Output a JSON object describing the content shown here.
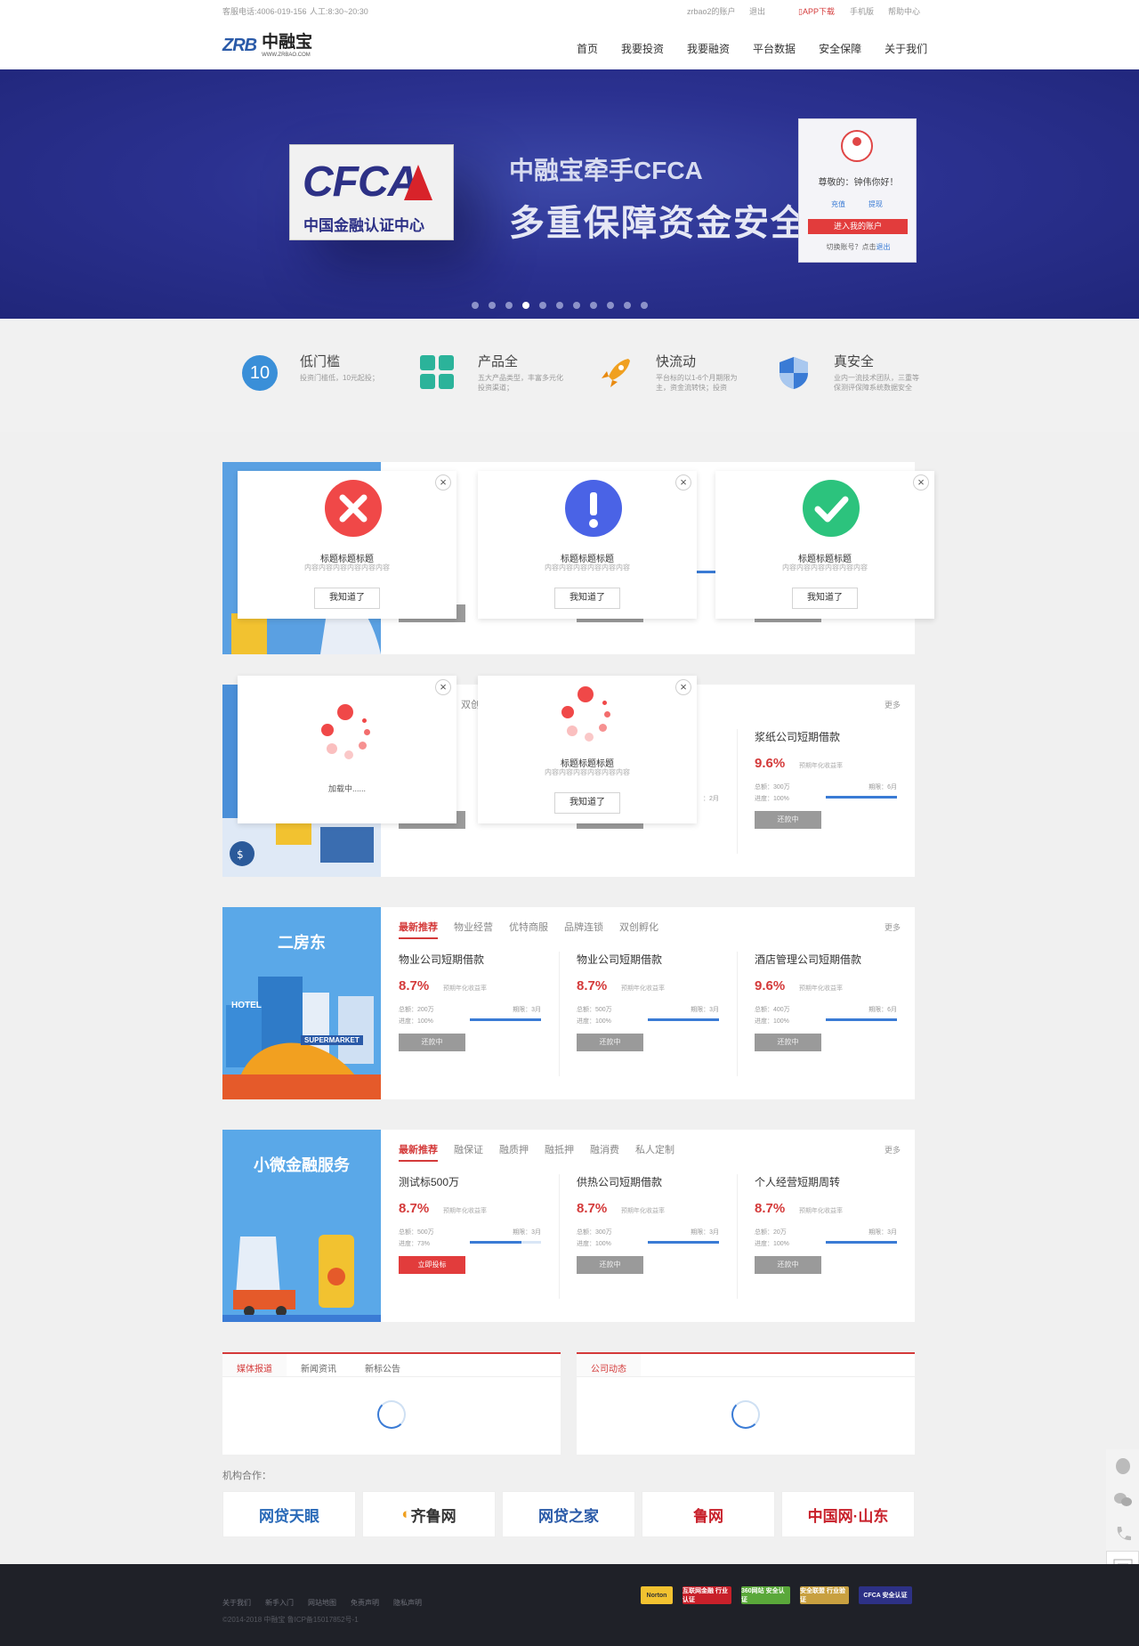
{
  "topbar": {
    "hotline": "客服电话:4006-019-156",
    "hours": "人工:8:30~20:30",
    "account": "zrbao2的账户",
    "logout": "退出",
    "app": "APP下载",
    "mobile": "手机版",
    "help": "帮助中心"
  },
  "header": {
    "logo_mark": "ZRB",
    "logo_cn": "中融宝",
    "logo_url": "WWW.ZRBAO.COM",
    "nav": [
      "首页",
      "我要投资",
      "我要融资",
      "平台数据",
      "安全保障",
      "关于我们"
    ]
  },
  "banner": {
    "cfca_big": "CFCA",
    "cfca_sub": "中国金融认证中心",
    "line1": "中融宝牵手CFCA",
    "line2": "多重保障资金安全",
    "dot_count": 11,
    "active_dot": 3
  },
  "login": {
    "greeting": "尊敬的：钟伟你好！",
    "recharge": "充值",
    "withdraw": "提现",
    "enter": "进入我的账户",
    "switch_text": "切换账号？点击",
    "switch_link": "退出"
  },
  "features": [
    {
      "icon": "ten-badge-icon",
      "icon_text": "10",
      "title": "低门槛",
      "desc": "投资门槛低，10元起投；"
    },
    {
      "icon": "grid-icon",
      "title": "产品全",
      "desc": "五大产品类型，丰富多元化投资渠道；"
    },
    {
      "icon": "rocket-icon",
      "title": "快流动",
      "desc": "平台标的以1-6个月期限为主，资金流转快；投资"
    },
    {
      "icon": "shield-icon",
      "title": "真安全",
      "desc": "业内一流技术团队，三重等保测评保障系统数据安全"
    }
  ],
  "sections": [
    {
      "name": "section-1",
      "more": "更多",
      "tabs": [],
      "items": [
        {
          "name": "",
          "rate": "",
          "rate_label": "",
          "total": "",
          "term": "",
          "progress": "",
          "progress_value": null,
          "button": ""
        }
      ]
    },
    {
      "name": "section-2",
      "more": "更多",
      "tabs": [
        "双创"
      ],
      "items": [
        {
          "name": "浆纸公司短期借款",
          "rate": "9.6%",
          "rate_label": "预期年化收益率",
          "total": "总额：300万",
          "term": "期限：6月",
          "progress": "进度：100%",
          "progress_value": 1.0,
          "button": "还款中"
        }
      ],
      "partial": {
        "suffix1": "式",
        "term2": "：2月",
        "button1": "还款中",
        "button2": "还款中"
      }
    },
    {
      "name": "section-property",
      "banner_title": "二房东",
      "banner_hotel": "HOTEL",
      "banner_market": "SUPERMARKET",
      "more": "更多",
      "tabs": [
        "最新推荐",
        "物业经营",
        "优特商服",
        "品牌连锁",
        "双创孵化"
      ],
      "items": [
        {
          "name": "物业公司短期借款",
          "rate": "8.7%",
          "rate_label": "预期年化收益率",
          "total": "总额：200万",
          "term": "期限：3月",
          "progress": "进度：100%",
          "progress_value": 1.0,
          "button": "还款中"
        },
        {
          "name": "物业公司短期借款",
          "rate": "8.7%",
          "rate_label": "预期年化收益率",
          "total": "总额：500万",
          "term": "期限：3月",
          "progress": "进度：100%",
          "progress_value": 1.0,
          "button": "还款中"
        },
        {
          "name": "酒店管理公司短期借款",
          "rate": "9.6%",
          "rate_label": "预期年化收益率",
          "total": "总额：400万",
          "term": "期限：6月",
          "progress": "进度：100%",
          "progress_value": 1.0,
          "button": "还款中"
        }
      ]
    },
    {
      "name": "section-micro",
      "banner_title": "小微金融服务",
      "more": "更多",
      "tabs": [
        "最新推荐",
        "融保证",
        "融质押",
        "融抵押",
        "融消费",
        "私人定制"
      ],
      "items": [
        {
          "name": "测试标500万",
          "rate": "8.7%",
          "rate_label": "预期年化收益率",
          "total": "总额：500万",
          "term": "期限：3月",
          "progress": "进度：73%",
          "progress_value": 0.73,
          "button": "立即投标"
        },
        {
          "name": "供热公司短期借款",
          "rate": "8.7%",
          "rate_label": "预期年化收益率",
          "total": "总额：300万",
          "term": "期限：3月",
          "progress": "进度：100%",
          "progress_value": 1.0,
          "button": "还款中"
        },
        {
          "name": "个人经营短期周转",
          "rate": "8.7%",
          "rate_label": "预期年化收益率",
          "total": "总额：20万",
          "term": "期限：3月",
          "progress": "进度：100%",
          "progress_value": 1.0,
          "button": "还款中"
        }
      ]
    }
  ],
  "news": {
    "left_tabs": [
      "媒体报道",
      "新闻资讯",
      "新标公告"
    ],
    "right_tabs": [
      "公司动态"
    ]
  },
  "partners": {
    "label": "机构合作：",
    "logos": [
      "网贷天眼",
      "齐鲁网",
      "网贷之家",
      "鲁网",
      "中国网·山东"
    ],
    "sub": [
      "www.p2peye.com",
      "iqilu.com",
      "w w w . w d z j . c o m",
      "",
      "sd.china.com.cn"
    ]
  },
  "footer": {
    "links": [
      "关于我们",
      "新手入门",
      "网站地图",
      "免责声明",
      "隐私声明"
    ],
    "copyright": "©2014-2018 中融宝 鲁ICP备15017852号-1",
    "badges": [
      "Norton",
      "互联网金融 行业认证",
      "360网站 安全认证",
      "安全联盟 行业验证",
      "CFCA 安全认证"
    ]
  },
  "modals": [
    {
      "type": "error",
      "icon": "error-x-icon",
      "color": "#f04848",
      "title": "标题标题标题",
      "text": "内容内容内容内容内容内容",
      "button": "我知道了"
    },
    {
      "type": "info",
      "icon": "exclamation-icon",
      "color": "#4a63e6",
      "title": "标题标题标题",
      "text": "内容内容内容内容内容内容",
      "button": "我知道了"
    },
    {
      "type": "success",
      "icon": "checkmark-icon",
      "color": "#2cc37d",
      "title": "标题标题标题",
      "text": "内容内容内容内容内容内容",
      "button": "我知道了"
    },
    {
      "type": "loading",
      "icon": "loading-spinner-icon",
      "color": "#f04848",
      "loading_text": "加载中......"
    },
    {
      "type": "loading-with-content",
      "icon": "loading-spinner-icon",
      "color": "#f04848",
      "title": "标题标题标题",
      "text": "内容内容内容内容内容内容",
      "button": "我知道了"
    }
  ]
}
